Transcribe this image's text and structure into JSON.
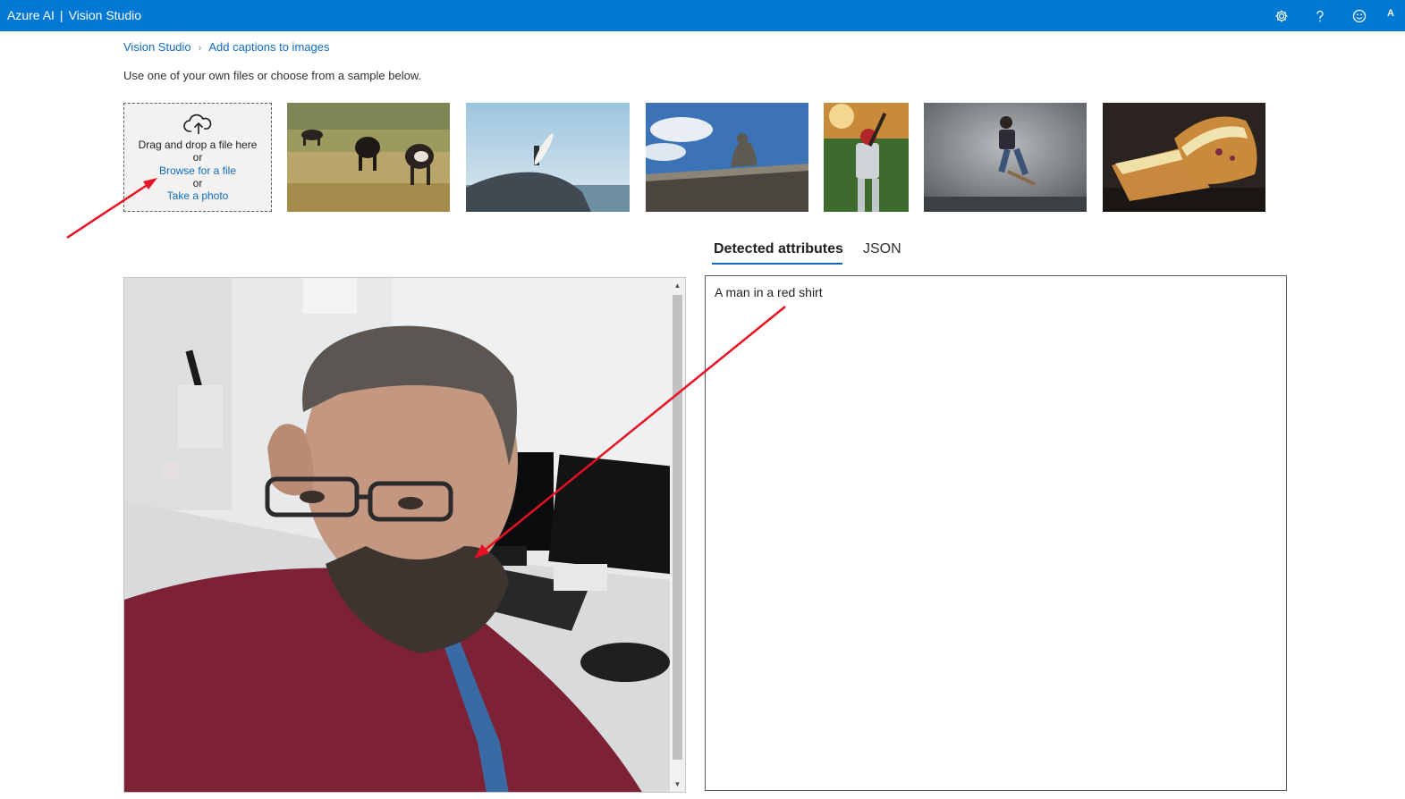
{
  "header": {
    "brand": "Azure AI",
    "separator": "|",
    "product": "Vision Studio",
    "icons": [
      "settings-gear-icon",
      "help-question-icon",
      "feedback-smiley-icon"
    ],
    "avatar": "A",
    "color": "#0078d4"
  },
  "breadcrumb": {
    "items": [
      "Vision Studio",
      "Add captions to images"
    ]
  },
  "intro_text": "Use one of your own files or choose from a sample below.",
  "upload": {
    "icon": "cloud-upload-icon",
    "drag_text": "Drag and drop a file here",
    "or1": "or",
    "browse_link": "Browse for a file",
    "or2": "or",
    "photo_link": "Take a photo"
  },
  "samples": [
    "cows-grazing-field",
    "surfer-on-rock",
    "building-statue-sky",
    "baseball-batter",
    "skateboarder-jump",
    "grilled-sandwich"
  ],
  "tabs": {
    "active": "Detected attributes",
    "inactive": "JSON"
  },
  "result": {
    "caption": "A man in a red shirt"
  },
  "annotations": {
    "arrow_color": "#e81123"
  }
}
